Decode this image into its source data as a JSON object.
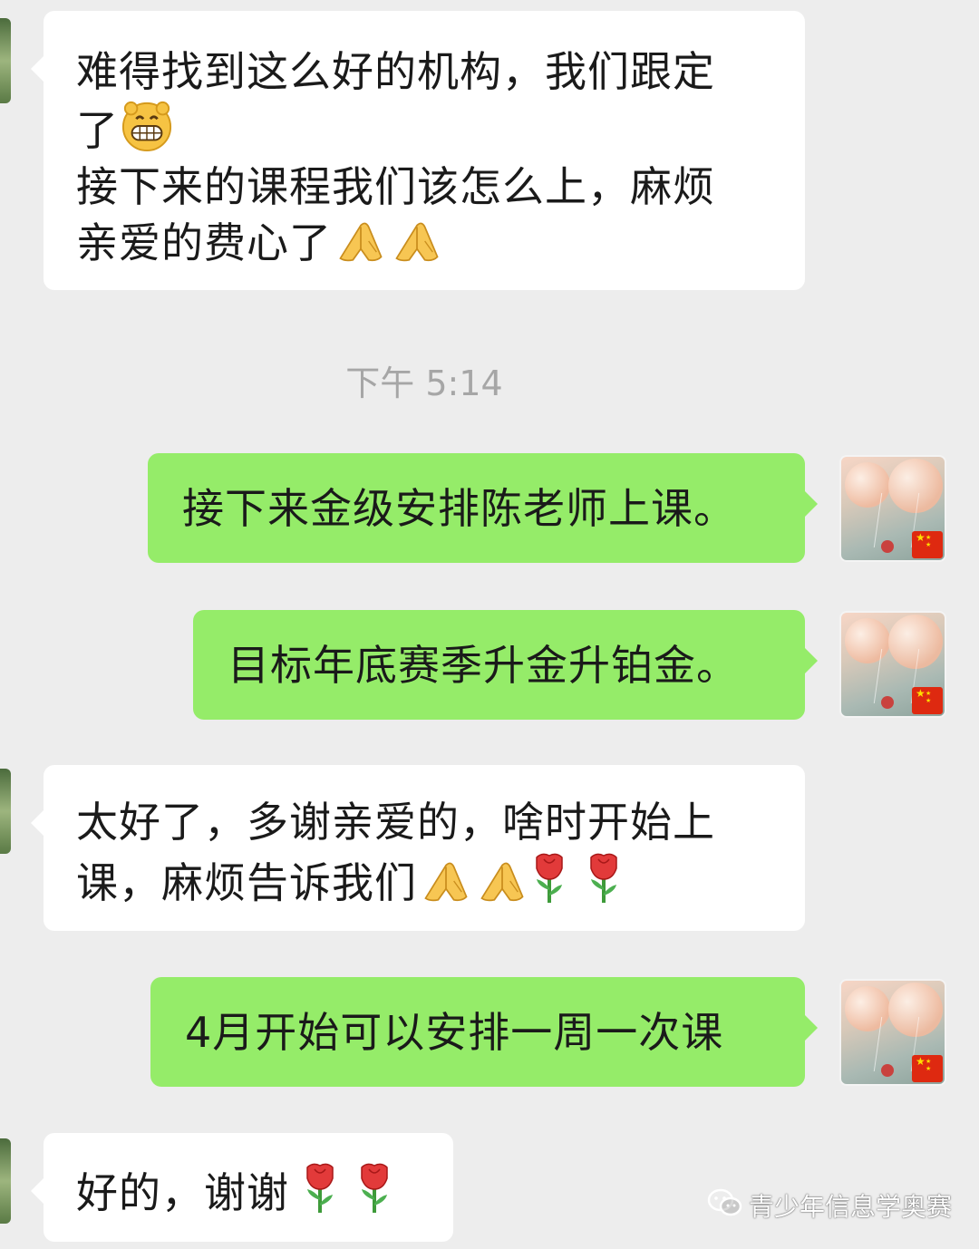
{
  "messages": [
    {
      "lines": [
        "难得找到这么好的机构，我们跟定",
        "了",
        "接下来的课程我们该怎么上，麻烦",
        "亲爱的费心了"
      ]
    },
    {
      "text": "接下来金级安排陈老师上课。"
    },
    {
      "text": "目标年底赛季升金升铂金。"
    },
    {
      "lines": [
        "太好了，多谢亲爱的，啥时开始上",
        "课，麻烦告诉我们"
      ]
    },
    {
      "text": "4月开始可以安排一周一次课"
    },
    {
      "text": "好的，谢谢"
    }
  ],
  "timestamp": "下午 5:14",
  "watermark": "青少年信息学奥赛",
  "icons": [
    "grin-emoji",
    "praying-hands-emoji",
    "rose-emoji",
    "wechat-icon",
    "avatar-image",
    "china-flag-icon"
  ],
  "colors": {
    "background": "#ededed",
    "incoming_bubble": "#ffffff",
    "outgoing_bubble": "#95ec69",
    "timestamp": "#a6a6a6"
  }
}
